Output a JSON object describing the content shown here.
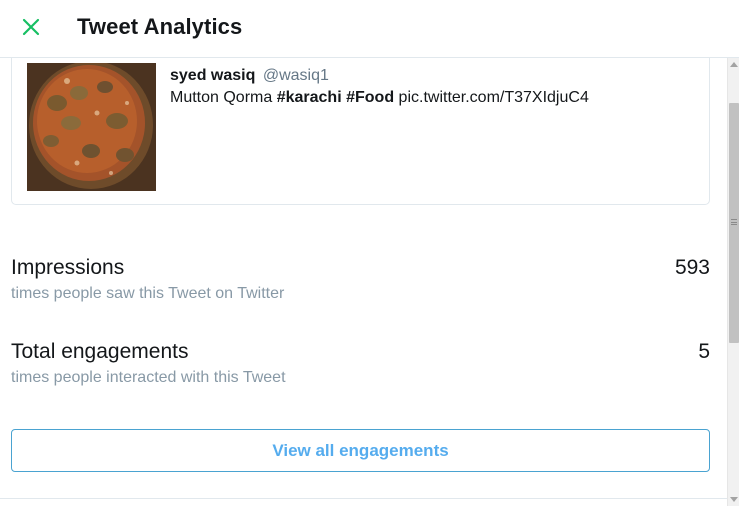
{
  "header": {
    "title": "Tweet Analytics",
    "close_icon": "close-x-icon",
    "accent": "#17bf63"
  },
  "tweet": {
    "author_name": "syed wasiq",
    "handle": "@wasiq1",
    "text_plain_1": "Mutton Qorma ",
    "hashtag_1": "#karachi",
    "text_space": " ",
    "hashtag_2": "#Food",
    "link": " pic.twitter.com/T37XIdjuC4",
    "image_alt": "photo of mutton qorma"
  },
  "metrics": [
    {
      "label": "Impressions",
      "value": "593",
      "description": "times people saw this Tweet on Twitter"
    },
    {
      "label": "Total engagements",
      "value": "5",
      "description": "times people interacted with this Tweet"
    }
  ],
  "actions": {
    "view_all_label": "View all engagements",
    "accent": "#55acee"
  }
}
